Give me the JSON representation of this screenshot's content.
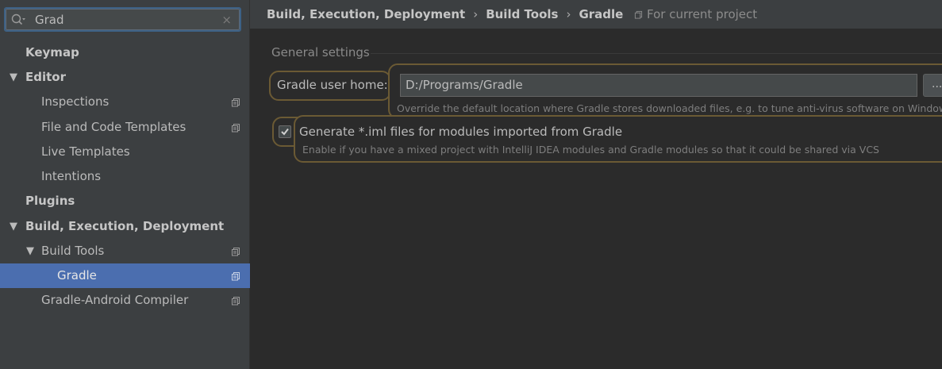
{
  "search": {
    "value": "Grad",
    "clear_symbol": "×",
    "icon": "search-icon"
  },
  "sidebar": {
    "items": [
      {
        "label": "Keymap"
      },
      {
        "label": "Editor",
        "arrow": "▼"
      },
      {
        "label": "Inspections"
      },
      {
        "label": "File and Code Templates"
      },
      {
        "label": "Live Templates"
      },
      {
        "label": "Intentions"
      },
      {
        "label": "Plugins"
      },
      {
        "label": "Build, Execution, Deployment",
        "arrow": "▼"
      },
      {
        "label": "Build Tools",
        "arrow": "▼"
      },
      {
        "label": "Gradle"
      },
      {
        "label": "Gradle-Android Compiler"
      }
    ]
  },
  "breadcrumb": {
    "items": [
      "Build, Execution, Deployment",
      "Build Tools",
      "Gradle"
    ],
    "separator": "›"
  },
  "scope_note": "For current project",
  "general": {
    "section_title": "General settings",
    "gradle_home_label": "Gradle user home:",
    "gradle_home_value": "D:/Programs/Gradle",
    "browse_label": "...",
    "gradle_home_hint": "Override the default location where Gradle stores downloaded files, e.g. to tune anti-virus software on Windows",
    "generate_iml_checked": true,
    "generate_iml_label": "Generate *.iml files for modules imported from Gradle",
    "generate_iml_hint": "Enable if you have a mixed project with IntelliJ IDEA modules and Gradle modules so that it could be shared via VCS"
  },
  "colors": {
    "selection": "#4b6eaf",
    "highlight_border": "#6b5a34",
    "search_focus": "#3d6185"
  }
}
